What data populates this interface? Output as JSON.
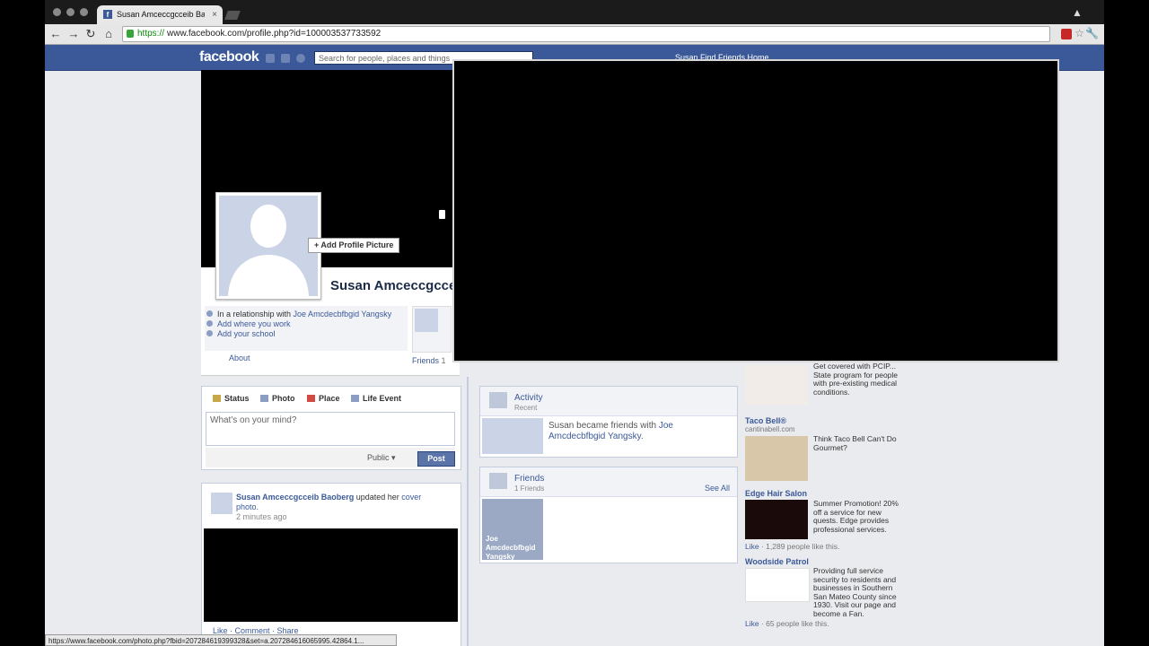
{
  "browser": {
    "tab_title": "Susan Amceccgcceib Baober",
    "tab_favicon": "f",
    "tab_close": "×",
    "url_scheme": "https://",
    "url_rest": "www.facebook.com/profile.php?id=100003537733592",
    "back_icon": "←",
    "forward_icon": "→",
    "reload_icon": "↻",
    "home_icon": "⌂",
    "star_icon": "☆",
    "wrench_icon": "🔧"
  },
  "fbbar": {
    "logo": "facebook",
    "search_placeholder": "Search for people, places and things",
    "right_links": "Susan   Find Friends   Home"
  },
  "profile": {
    "add_picture": "+ Add Profile Picture",
    "name": "Susan Amceccgcce",
    "relationship_prefix": "In a relationship with ",
    "relationship_partner": "Joe Amcdecbfbgid Yangsky",
    "add_work": "Add where you work",
    "add_school": "Add your school",
    "about": "About",
    "friends_label": "Friends",
    "friends_count": "1"
  },
  "composer": {
    "tabs": [
      "Status",
      "Photo",
      "Place",
      "Life Event"
    ],
    "placeholder": "What's on your mind?",
    "privacy": "Public ▾",
    "post": "Post"
  },
  "story": {
    "author": "Susan Amceccgcceib Baoberg",
    "action": " updated her ",
    "object": "cover photo.",
    "time": "2 minutes ago",
    "actions": "Like · Comment · Share"
  },
  "activity": {
    "title": "Activity",
    "sub": "Recent",
    "text_prefix": "Susan became friends with ",
    "text_link": "Joe Amcdecbfbgid Yangsky",
    "text_suffix": "."
  },
  "friends_box": {
    "title": "Friends",
    "sub": "1 Friends",
    "see_all": "See All",
    "friend_name": "Joe Amcdecbfbgid Yangsky"
  },
  "ads": [
    {
      "title": "",
      "url": "",
      "text": "Get covered with PCIP... State program for people with pre-existing medical conditions.",
      "like": ""
    },
    {
      "title": "Taco Bell®",
      "url": "cantinabell.com",
      "text": "Think Taco Bell Can't Do Gourmet?",
      "like": ""
    },
    {
      "title": "Edge Hair Salon",
      "url": "",
      "text": "Summer Promotion! 20% off a service for new quests. Edge provides professional services.",
      "like_link": "Like",
      "like": " · 1,289 people like this."
    },
    {
      "title": "Woodside Patrol",
      "url": "",
      "text": "Providing full service security to residents and businesses in Southern San Mateo County since 1930. Visit our page and become a Fan.",
      "like_link": "Like",
      "like": " · 65 people like this."
    }
  ],
  "statusbar": "https://www.facebook.com/photo.php?fbid=207284619399328&set=a.207284616065995.42864.1..."
}
